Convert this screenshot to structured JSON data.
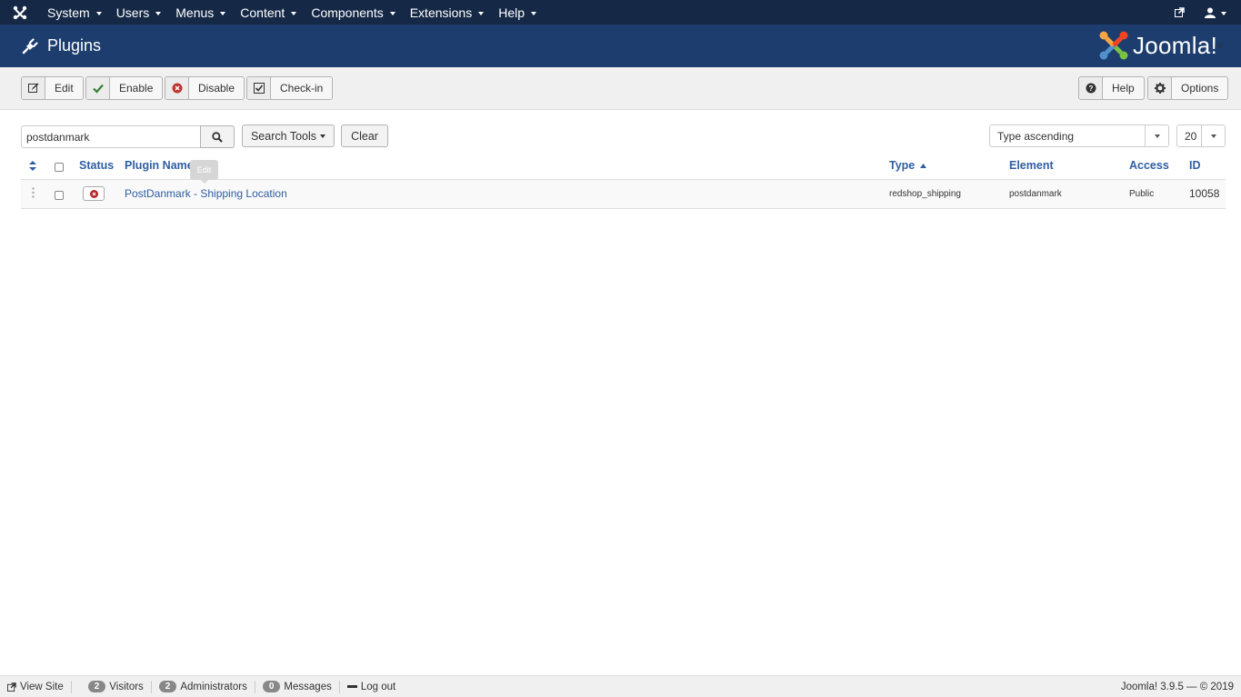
{
  "nav": {
    "items": [
      {
        "label": "System"
      },
      {
        "label": "Users"
      },
      {
        "label": "Menus"
      },
      {
        "label": "Content"
      },
      {
        "label": "Components"
      },
      {
        "label": "Extensions"
      },
      {
        "label": "Help"
      }
    ]
  },
  "header": {
    "title": "Plugins",
    "brand": "Joomla!"
  },
  "toolbar": {
    "edit": "Edit",
    "enable": "Enable",
    "disable": "Disable",
    "checkin": "Check-in",
    "help": "Help",
    "options": "Options"
  },
  "filters": {
    "search_value": "postdanmark",
    "search_tools": "Search Tools",
    "clear": "Clear",
    "ordering": "Type ascending",
    "limit": "20"
  },
  "table": {
    "columns": {
      "status": "Status",
      "name": "Plugin Name",
      "type": "Type",
      "element": "Element",
      "access": "Access",
      "id": "ID"
    },
    "tooltip": "Edit",
    "rows": [
      {
        "name": "PostDanmark - Shipping Location",
        "type": "redshop_shipping",
        "element": "postdanmark",
        "access": "Public",
        "id": "10058",
        "status": "disabled"
      }
    ]
  },
  "footer": {
    "view_site": "View Site",
    "visitors_count": "2",
    "visitors": "Visitors",
    "admins_count": "2",
    "admins": "Administrators",
    "messages_count": "0",
    "messages": "Messages",
    "logout": "Log out",
    "version": "Joomla! 3.9.5 — © 2019"
  },
  "colors": {
    "navbar": "#152947",
    "header": "#1c3d6e",
    "link": "#2f5ea2",
    "disabled_status": "#b32a2a"
  }
}
